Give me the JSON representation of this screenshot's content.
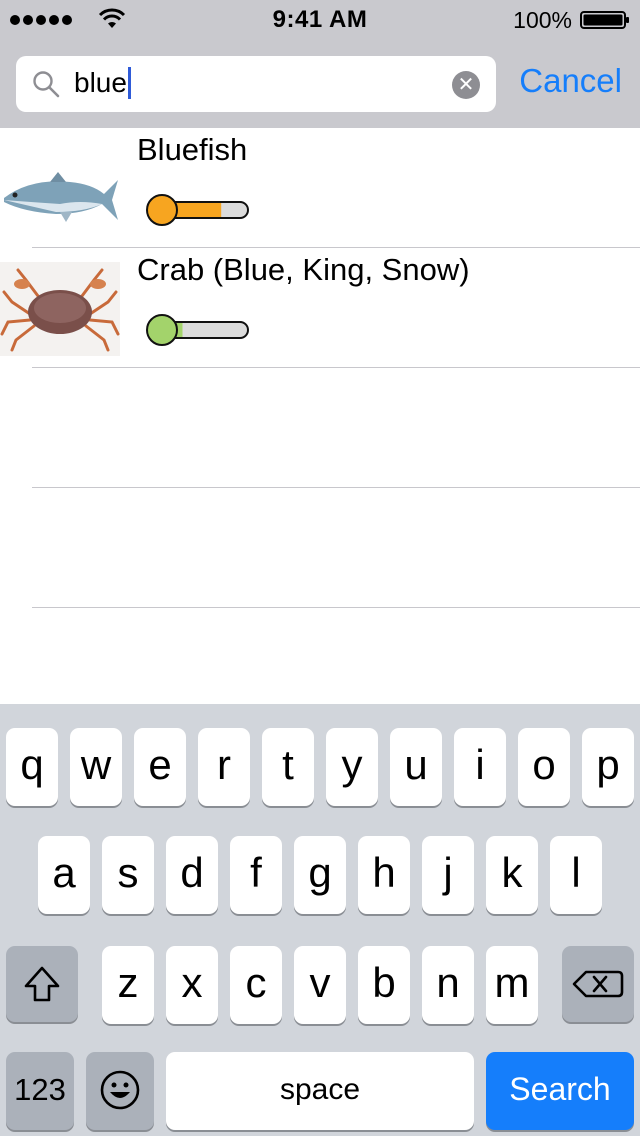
{
  "status_bar": {
    "time": "9:41 AM",
    "battery_percent": "100%",
    "signal_dots": 5,
    "icons": [
      "signal-dots-icon",
      "wifi-icon",
      "battery-icon"
    ]
  },
  "search": {
    "value": "blue",
    "clear_icon": "clear-x-icon",
    "search_icon": "magnifier-icon",
    "cancel_label": "Cancel"
  },
  "results": [
    {
      "name": "Bluefish",
      "image": "bluefish-image",
      "meter_level": 0.7,
      "meter_color": "#f7a520"
    },
    {
      "name": "Crab (Blue, King, Snow)",
      "image": "crab-image",
      "meter_level": 0.25,
      "meter_color": "#a3d36b"
    }
  ],
  "keyboard": {
    "row1": [
      "q",
      "w",
      "e",
      "r",
      "t",
      "y",
      "u",
      "i",
      "o",
      "p"
    ],
    "row2": [
      "a",
      "s",
      "d",
      "f",
      "g",
      "h",
      "j",
      "k",
      "l"
    ],
    "row3": [
      "z",
      "x",
      "c",
      "v",
      "b",
      "n",
      "m"
    ],
    "numbers_label": "123",
    "space_label": "space",
    "search_label": "Search",
    "icons": [
      "shift-icon",
      "backspace-icon",
      "emoji-icon"
    ]
  },
  "colors": {
    "accent": "#157efb",
    "bar_background": "#c9c9ce",
    "keyboard_background": "#d1d5db"
  }
}
